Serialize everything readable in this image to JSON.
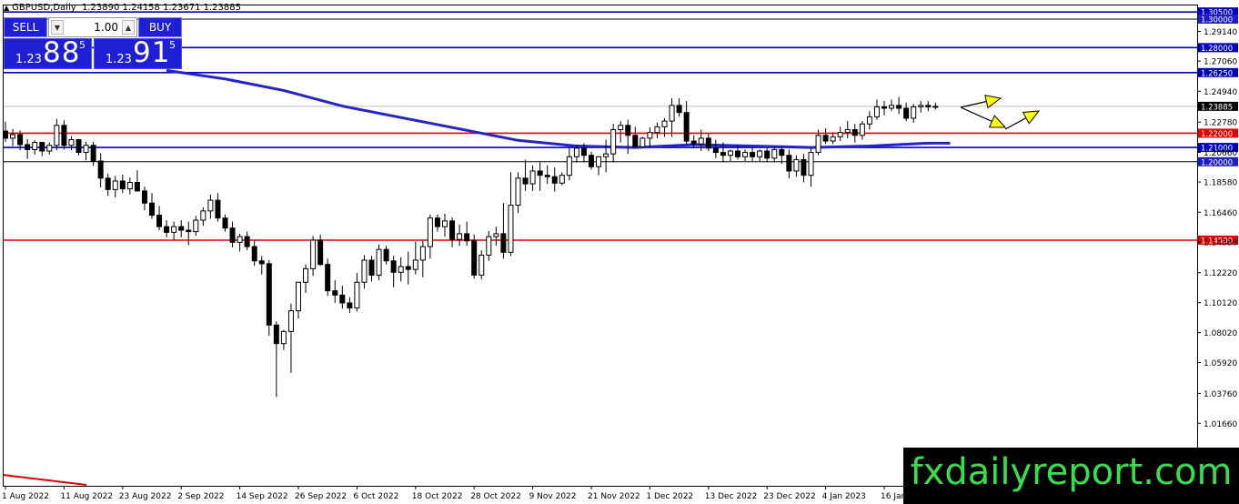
{
  "header": {
    "symbol": "GBPUSD,Daily",
    "ohlc": "1.23890 1.24158 1.23671 1.23885"
  },
  "trade_panel": {
    "sell_label": "SELL",
    "buy_label": "BUY",
    "lot": "1.00",
    "sell_prefix": "1.23",
    "sell_big": "88",
    "sell_sup": "5",
    "buy_prefix": "1.23",
    "buy_big": "91",
    "buy_sup": "5"
  },
  "watermark": "fxdailyreport.com",
  "colors": {
    "accent_blue": "#1f1fd6",
    "level_red": "#e00000",
    "level_blue": "#0000c0",
    "ma_blue": "#2424c8",
    "arrow_yellow": "#ffff00",
    "brand_green": "#35e04a"
  },
  "chart_data": {
    "type": "candlestick",
    "title": "GBPUSD,Daily",
    "ylim": [
      1.0,
      1.3075
    ],
    "y_ticks": [
      "1.29140",
      "1.27060",
      "1.24940",
      "1.22780",
      "1.20660",
      "1.18580",
      "1.16460",
      "1.14380",
      "1.12220",
      "1.10120",
      "1.08020",
      "1.05920",
      "1.03760",
      "1.01660"
    ],
    "x_ticks": [
      "1 Aug 2022",
      "11 Aug 2022",
      "23 Aug 2022",
      "2 Sep 2022",
      "14 Sep 2022",
      "26 Sep 2022",
      "6 Oct 2022",
      "18 Oct 2022",
      "28 Oct 2022",
      "9 Nov 2022",
      "21 Nov 2022",
      "1 Dec 2022",
      "13 Dec 2022",
      "23 Dec 2022",
      "4 Jan 2023",
      "16 Jan"
    ],
    "x_tick_index": [
      0,
      8,
      16,
      24,
      32,
      40,
      48,
      56,
      64,
      72,
      80,
      88,
      96,
      104,
      112,
      120
    ],
    "current_price": {
      "value": 1.23885,
      "label": "1.23885"
    },
    "levels": [
      {
        "value": 1.305,
        "label": "1.30500",
        "color": "#0000c0"
      },
      {
        "value": 1.3,
        "label": "1.30000",
        "color": "#000000"
      },
      {
        "value": 1.28,
        "label": "1.28000",
        "color": "#0000c0"
      },
      {
        "value": 1.2625,
        "label": "1.26250",
        "color": "#0000c0"
      },
      {
        "value": 1.22,
        "label": "1.22000",
        "color": "#e00000"
      },
      {
        "value": 1.21,
        "label": "1.21000",
        "color": "#0000c0"
      },
      {
        "value": 1.2,
        "label": "1.20000",
        "color": "#000000"
      },
      {
        "value": 1.145,
        "label": "1.14500",
        "color": "#e00000"
      }
    ],
    "moving_average": [
      {
        "i": 22,
        "v": 1.264
      },
      {
        "i": 30,
        "v": 1.258
      },
      {
        "i": 38,
        "v": 1.25
      },
      {
        "i": 46,
        "v": 1.239
      },
      {
        "i": 54,
        "v": 1.231
      },
      {
        "i": 62,
        "v": 1.223
      },
      {
        "i": 70,
        "v": 1.215
      },
      {
        "i": 78,
        "v": 1.211
      },
      {
        "i": 86,
        "v": 1.21
      },
      {
        "i": 94,
        "v": 1.212
      },
      {
        "i": 102,
        "v": 1.211
      },
      {
        "i": 110,
        "v": 1.21
      },
      {
        "i": 118,
        "v": 1.211
      },
      {
        "i": 126,
        "v": 1.213
      },
      {
        "i": 129,
        "v": 1.213
      }
    ],
    "candles": [
      [
        1.2215,
        1.228,
        1.214,
        1.2165
      ],
      [
        1.2165,
        1.223,
        1.211,
        1.219
      ],
      [
        1.219,
        1.222,
        1.208,
        1.212
      ],
      [
        1.212,
        1.216,
        1.202,
        1.2085
      ],
      [
        1.2085,
        1.215,
        1.205,
        1.2135
      ],
      [
        1.2135,
        1.214,
        1.204,
        1.2075
      ],
      [
        1.2075,
        1.2135,
        1.205,
        1.2115
      ],
      [
        1.2115,
        1.23,
        1.208,
        1.2255
      ],
      [
        1.2255,
        1.229,
        1.2085,
        1.2115
      ],
      [
        1.2115,
        1.218,
        1.208,
        1.2155
      ],
      [
        1.2155,
        1.216,
        1.2045,
        1.2065
      ],
      [
        1.2065,
        1.214,
        1.201,
        1.2115
      ],
      [
        1.2115,
        1.214,
        1.197,
        1.2005
      ],
      [
        1.2005,
        1.206,
        1.182,
        1.1885
      ],
      [
        1.1885,
        1.1915,
        1.176,
        1.1805
      ],
      [
        1.1805,
        1.19,
        1.175,
        1.1865
      ],
      [
        1.1865,
        1.191,
        1.178,
        1.181
      ],
      [
        1.181,
        1.189,
        1.177,
        1.1855
      ],
      [
        1.1855,
        1.194,
        1.18,
        1.1795
      ],
      [
        1.1795,
        1.1825,
        1.166,
        1.171
      ],
      [
        1.171,
        1.178,
        1.16,
        1.1625
      ],
      [
        1.1625,
        1.169,
        1.152,
        1.1545
      ],
      [
        1.1545,
        1.159,
        1.147,
        1.1505
      ],
      [
        1.1505,
        1.158,
        1.145,
        1.1545
      ],
      [
        1.1545,
        1.159,
        1.147,
        1.152
      ],
      [
        1.152,
        1.158,
        1.1415,
        1.151
      ],
      [
        1.151,
        1.162,
        1.148,
        1.159
      ],
      [
        1.159,
        1.168,
        1.155,
        1.1655
      ],
      [
        1.1655,
        1.177,
        1.16,
        1.173
      ],
      [
        1.173,
        1.178,
        1.158,
        1.1605
      ],
      [
        1.1605,
        1.163,
        1.151,
        1.1535
      ],
      [
        1.1535,
        1.158,
        1.14,
        1.1435
      ],
      [
        1.1435,
        1.1495,
        1.137,
        1.1475
      ],
      [
        1.1475,
        1.151,
        1.138,
        1.1405
      ],
      [
        1.1405,
        1.145,
        1.127,
        1.1305
      ],
      [
        1.1305,
        1.134,
        1.121,
        1.1285
      ],
      [
        1.1285,
        1.131,
        1.078,
        1.0855
      ],
      [
        1.0855,
        1.088,
        1.035,
        1.0725
      ],
      [
        1.0725,
        1.082,
        1.068,
        1.081
      ],
      [
        1.081,
        1.1005,
        1.052,
        1.0955
      ],
      [
        1.0955,
        1.112,
        1.09,
        1.1155
      ],
      [
        1.1155,
        1.128,
        1.108,
        1.125
      ],
      [
        1.125,
        1.148,
        1.12,
        1.145
      ],
      [
        1.145,
        1.149,
        1.127,
        1.128
      ],
      [
        1.128,
        1.132,
        1.106,
        1.1095
      ],
      [
        1.1095,
        1.117,
        1.101,
        1.1065
      ],
      [
        1.1065,
        1.113,
        1.097,
        1.101
      ],
      [
        1.101,
        1.105,
        1.094,
        1.0975
      ],
      [
        1.0975,
        1.122,
        1.095,
        1.1155
      ],
      [
        1.1155,
        1.1345,
        1.111,
        1.131
      ],
      [
        1.131,
        1.134,
        1.116,
        1.1205
      ],
      [
        1.1205,
        1.142,
        1.117,
        1.1385
      ],
      [
        1.1385,
        1.141,
        1.128,
        1.1305
      ],
      [
        1.1305,
        1.134,
        1.112,
        1.1225
      ],
      [
        1.1225,
        1.133,
        1.116,
        1.1265
      ],
      [
        1.1265,
        1.137,
        1.114,
        1.1245
      ],
      [
        1.1245,
        1.144,
        1.121,
        1.131
      ],
      [
        1.131,
        1.1445,
        1.119,
        1.1405
      ],
      [
        1.1405,
        1.163,
        1.132,
        1.1605
      ],
      [
        1.1605,
        1.163,
        1.151,
        1.1545
      ],
      [
        1.1545,
        1.1635,
        1.1475,
        1.1585
      ],
      [
        1.1585,
        1.161,
        1.14,
        1.1455
      ],
      [
        1.1455,
        1.156,
        1.141,
        1.1495
      ],
      [
        1.1495,
        1.158,
        1.141,
        1.1445
      ],
      [
        1.1445,
        1.149,
        1.118,
        1.1205
      ],
      [
        1.1205,
        1.138,
        1.1175,
        1.1345
      ],
      [
        1.1345,
        1.1515,
        1.1305,
        1.1475
      ],
      [
        1.1475,
        1.1545,
        1.141,
        1.1495
      ],
      [
        1.1495,
        1.171,
        1.132,
        1.1365
      ],
      [
        1.1365,
        1.1925,
        1.134,
        1.1695
      ],
      [
        1.1695,
        1.1925,
        1.164,
        1.1885
      ],
      [
        1.1885,
        1.2015,
        1.1795,
        1.1845
      ],
      [
        1.1845,
        1.1975,
        1.1795,
        1.1935
      ],
      [
        1.1935,
        1.1995,
        1.1795,
        1.1905
      ],
      [
        1.1905,
        1.1975,
        1.1845,
        1.1895
      ],
      [
        1.1895,
        1.196,
        1.179,
        1.185
      ],
      [
        1.185,
        1.1925,
        1.1835,
        1.1905
      ],
      [
        1.1905,
        1.2095,
        1.187,
        1.2035
      ],
      [
        1.2035,
        1.212,
        1.1995,
        1.2095
      ],
      [
        1.2095,
        1.213,
        1.1995,
        1.2045
      ],
      [
        1.2045,
        1.207,
        1.1945,
        1.1965
      ],
      [
        1.1965,
        1.204,
        1.1905,
        1.2035
      ],
      [
        1.2035,
        1.2155,
        1.1925,
        1.2055
      ],
      [
        1.2055,
        1.2265,
        1.1995,
        1.2225
      ],
      [
        1.2225,
        1.2285,
        1.2135,
        1.2255
      ],
      [
        1.2255,
        1.2295,
        1.2055,
        1.2185
      ],
      [
        1.2185,
        1.2245,
        1.2105,
        1.2105
      ],
      [
        1.2105,
        1.2175,
        1.2105,
        1.2165
      ],
      [
        1.2165,
        1.224,
        1.21,
        1.2205
      ],
      [
        1.2205,
        1.2275,
        1.2165,
        1.2245
      ],
      [
        1.2245,
        1.2305,
        1.2175,
        1.2285
      ],
      [
        1.2285,
        1.2445,
        1.2175,
        1.2395
      ],
      [
        1.2395,
        1.2445,
        1.2315,
        1.2345
      ],
      [
        1.2345,
        1.2425,
        1.2125,
        1.2145
      ],
      [
        1.2145,
        1.2185,
        1.2095,
        1.2125
      ],
      [
        1.2125,
        1.2225,
        1.2075,
        1.2165
      ],
      [
        1.2165,
        1.2195,
        1.2075,
        1.2095
      ],
      [
        1.2095,
        1.2155,
        1.2025,
        1.2065
      ],
      [
        1.2065,
        1.2135,
        1.1995,
        1.2045
      ],
      [
        1.2045,
        1.2085,
        1.2005,
        1.2075
      ],
      [
        1.2075,
        1.2115,
        1.2015,
        1.2035
      ],
      [
        1.2035,
        1.2085,
        1.2005,
        1.2065
      ],
      [
        1.2065,
        1.2105,
        1.2005,
        1.2035
      ],
      [
        1.2035,
        1.2085,
        1.2005,
        1.2075
      ],
      [
        1.2075,
        1.2095,
        1.1995,
        1.2025
      ],
      [
        1.2025,
        1.2105,
        1.1995,
        1.2085
      ],
      [
        1.2085,
        1.2115,
        1.1985,
        1.2045
      ],
      [
        1.2045,
        1.2085,
        1.1885,
        1.1935
      ],
      [
        1.1935,
        1.2045,
        1.1895,
        1.2015
      ],
      [
        1.2015,
        1.2055,
        1.1855,
        1.1905
      ],
      [
        1.1905,
        1.2105,
        1.1825,
        1.2065
      ],
      [
        1.2065,
        1.2225,
        1.2045,
        1.2185
      ],
      [
        1.2185,
        1.2235,
        1.2125,
        1.2145
      ],
      [
        1.2145,
        1.2205,
        1.2125,
        1.2175
      ],
      [
        1.2175,
        1.2245,
        1.2145,
        1.2205
      ],
      [
        1.2205,
        1.2285,
        1.2165,
        1.2225
      ],
      [
        1.2225,
        1.2265,
        1.2135,
        1.2185
      ],
      [
        1.2185,
        1.2285,
        1.2155,
        1.2265
      ],
      [
        1.2265,
        1.2355,
        1.2225,
        1.2315
      ],
      [
        1.2315,
        1.2435,
        1.2295,
        1.2385
      ],
      [
        1.2385,
        1.2425,
        1.2325,
        1.2375
      ],
      [
        1.2375,
        1.2435,
        1.2355,
        1.2395
      ],
      [
        1.2395,
        1.2455,
        1.2335,
        1.2375
      ],
      [
        1.2375,
        1.2415,
        1.2285,
        1.2305
      ],
      [
        1.2305,
        1.2405,
        1.2275,
        1.2385
      ],
      [
        1.2385,
        1.2425,
        1.2345,
        1.2395
      ],
      [
        1.2395,
        1.2425,
        1.2355,
        1.2385
      ],
      [
        1.2385,
        1.2415,
        1.2365,
        1.2388
      ]
    ]
  }
}
